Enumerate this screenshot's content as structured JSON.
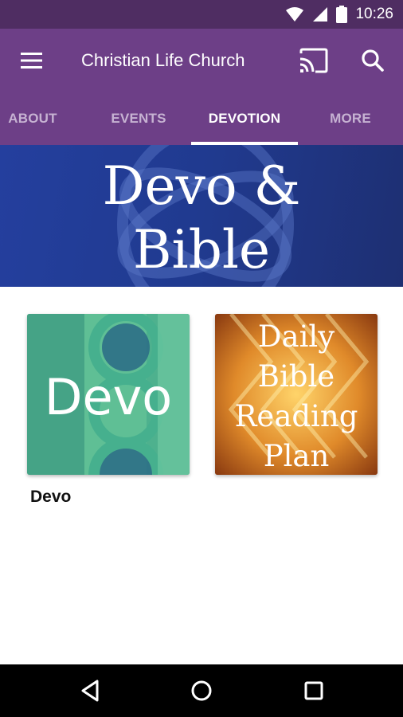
{
  "status_bar": {
    "time": "10:26",
    "icons": [
      "wifi-icon",
      "cell-signal-icon",
      "battery-icon"
    ]
  },
  "app_bar": {
    "title": "Christian Life Church",
    "actions": [
      "menu-icon",
      "cast-icon",
      "search-icon"
    ]
  },
  "tabs": [
    {
      "label": "ABOUT",
      "active": false
    },
    {
      "label": "EVENTS",
      "active": false
    },
    {
      "label": "DEVOTION",
      "active": true
    },
    {
      "label": "MORE",
      "active": false
    }
  ],
  "hero": {
    "line1": "Devo &",
    "line2": "Bible"
  },
  "cards": [
    {
      "image_text": "Devo",
      "caption": "Devo"
    },
    {
      "image_text_lines": [
        "Daily",
        "Bible",
        "Reading",
        "Plan"
      ]
    }
  ],
  "nav_bar": {
    "buttons": [
      "back-icon",
      "home-icon",
      "recents-icon"
    ]
  },
  "colors": {
    "status_bar": "#4f2d62",
    "app_bar": "#6d3f87",
    "hero_blue": "#203a8f",
    "devo_green": "#5fbf95",
    "plan_orange": "#c76a1e"
  }
}
